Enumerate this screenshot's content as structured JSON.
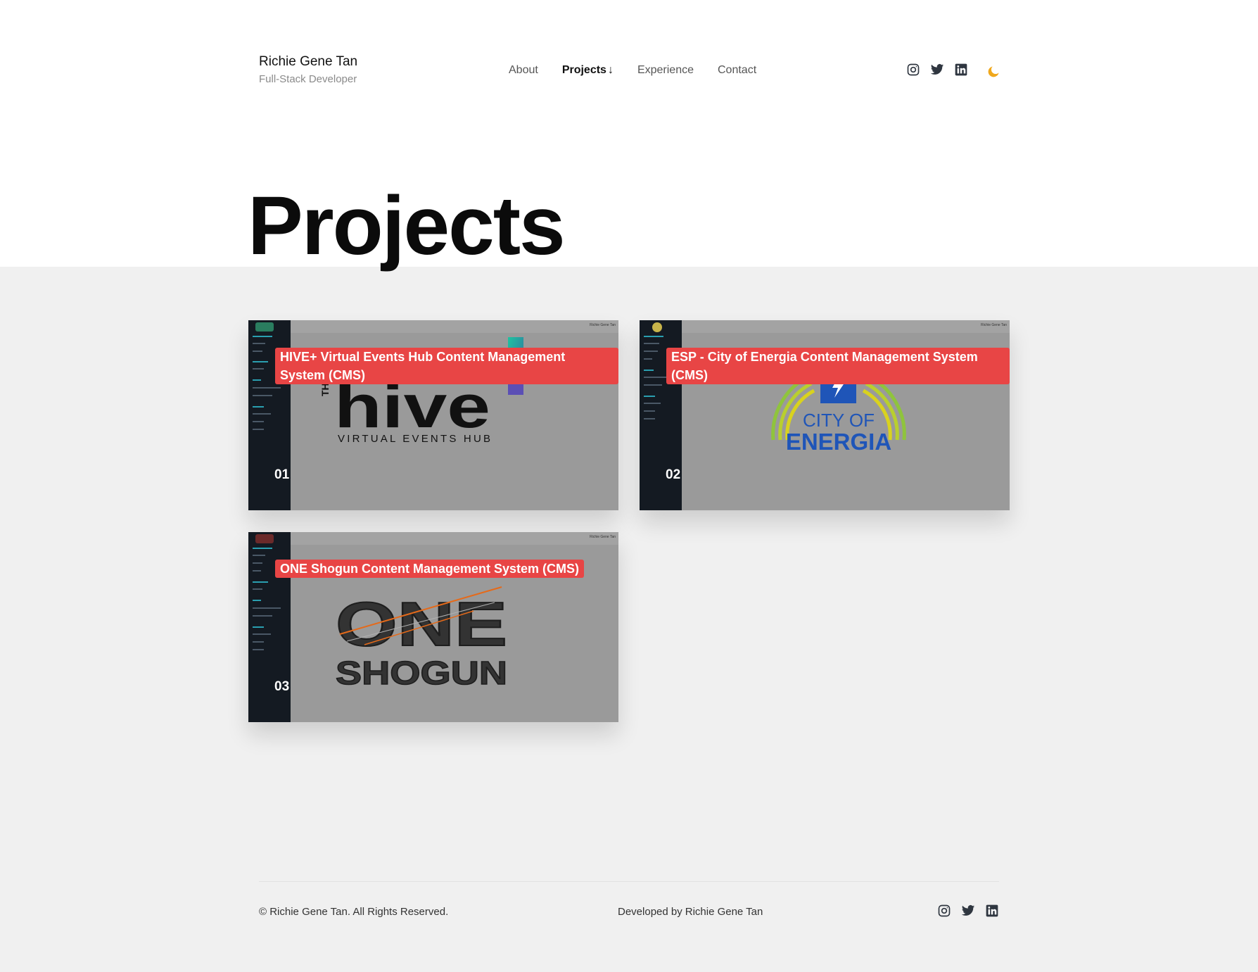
{
  "header": {
    "name": "Richie Gene Tan",
    "subtitle": "Full-Stack Developer",
    "nav": [
      {
        "label": "About"
      },
      {
        "label": "Projects",
        "suffix": "↓"
      },
      {
        "label": "Experience"
      },
      {
        "label": "Contact"
      }
    ],
    "social_icons": [
      "instagram-icon",
      "twitter-icon",
      "linkedin-icon"
    ],
    "theme_icon": "moon-icon"
  },
  "page_title": "Projects",
  "projects": [
    {
      "number": "01",
      "title": "HIVE+ Virtual Events Hub Content Management System (CMS)",
      "topbar_text": "Richie Gene Tan",
      "logo": {
        "top": "THE",
        "main": "hive",
        "sub": "VIRTUAL EVENTS HUB"
      }
    },
    {
      "number": "02",
      "title": "ESP - City of Energia Content Management System (CMS)",
      "topbar_text": "Richie Gene Tan",
      "logo": {
        "line1": "CITY OF",
        "line2": "ENERGIA"
      }
    },
    {
      "number": "03",
      "title": "ONE Shogun Content Management System (CMS)",
      "topbar_text": "Richie Gene Tan",
      "logo": {
        "line1": "ONE",
        "line2": "SHOGUN"
      }
    }
  ],
  "footer": {
    "copyright": "© Richie Gene Tan. All Rights Reserved.",
    "developed_by": "Developed by",
    "developer": "Richie Gene Tan"
  },
  "colors": {
    "accent": "#e84545",
    "theme_icon": "#f0a81c",
    "band_bg": "#f0f0f0",
    "card_bg": "#9a9a9a",
    "sidebar_bg": "#141a22"
  }
}
